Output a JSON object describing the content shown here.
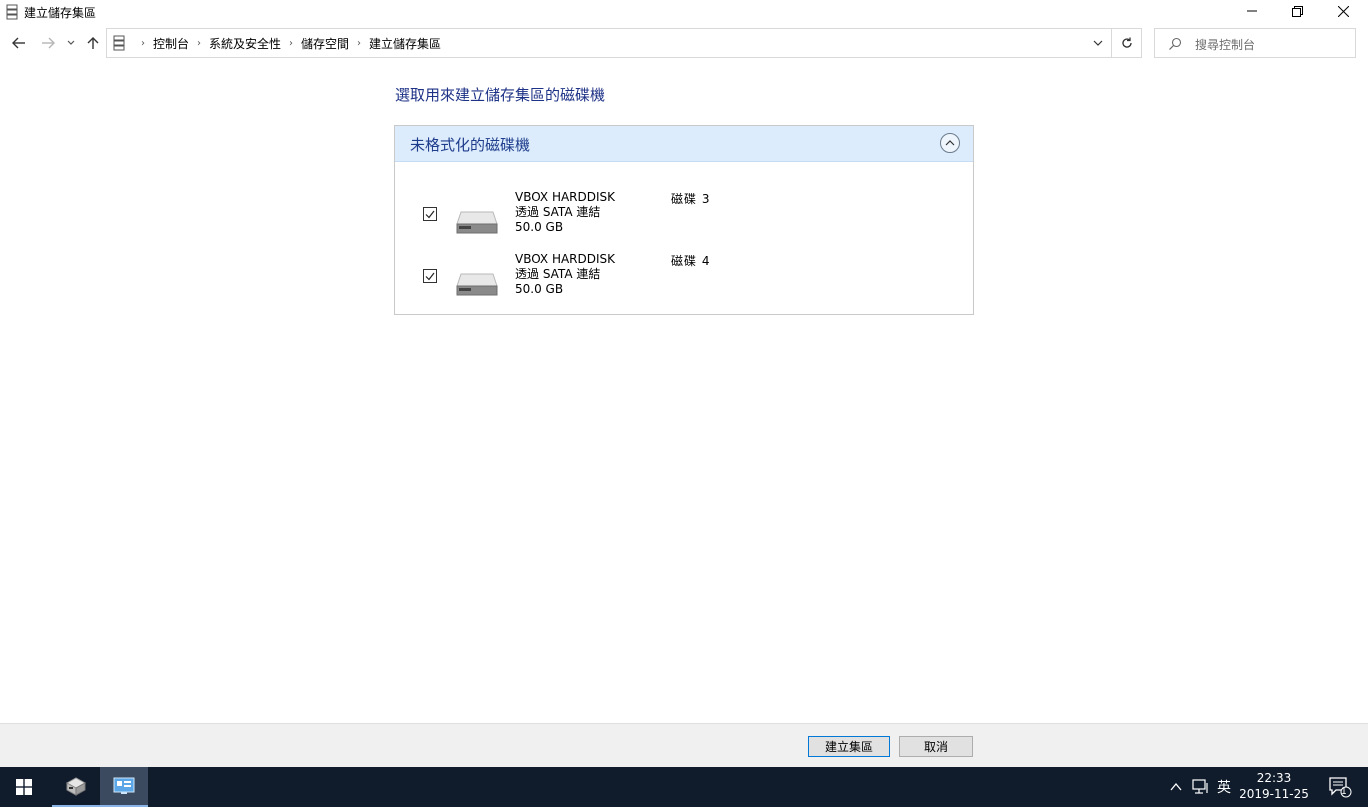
{
  "window": {
    "title": "建立儲存集區"
  },
  "breadcrumb": {
    "items": [
      "控制台",
      "系統及安全性",
      "儲存空間",
      "建立儲存集區"
    ]
  },
  "search": {
    "placeholder": "搜尋控制台"
  },
  "main": {
    "heading": "選取用來建立儲存集區的磁碟機",
    "group": {
      "title": "未格式化的磁碟機",
      "collapsed": false,
      "disks": [
        {
          "checked": true,
          "name": "VBOX HARDDISK",
          "connection": "透過 SATA 連結",
          "size": "50.0 GB",
          "disk_number": "磁碟 3"
        },
        {
          "checked": true,
          "name": "VBOX HARDDISK",
          "connection": "透過 SATA 連結",
          "size": "50.0 GB",
          "disk_number": "磁碟 4"
        }
      ]
    }
  },
  "actions": {
    "create_label": "建立集區",
    "cancel_label": "取消"
  },
  "taskbar": {
    "ime": "英",
    "time": "22:33",
    "date": "2019-11-25",
    "notification_count": "1"
  },
  "colors": {
    "heading": "#1e3287",
    "group_header_bg": "#dcecfc",
    "taskbar_bg": "#101c2c"
  }
}
